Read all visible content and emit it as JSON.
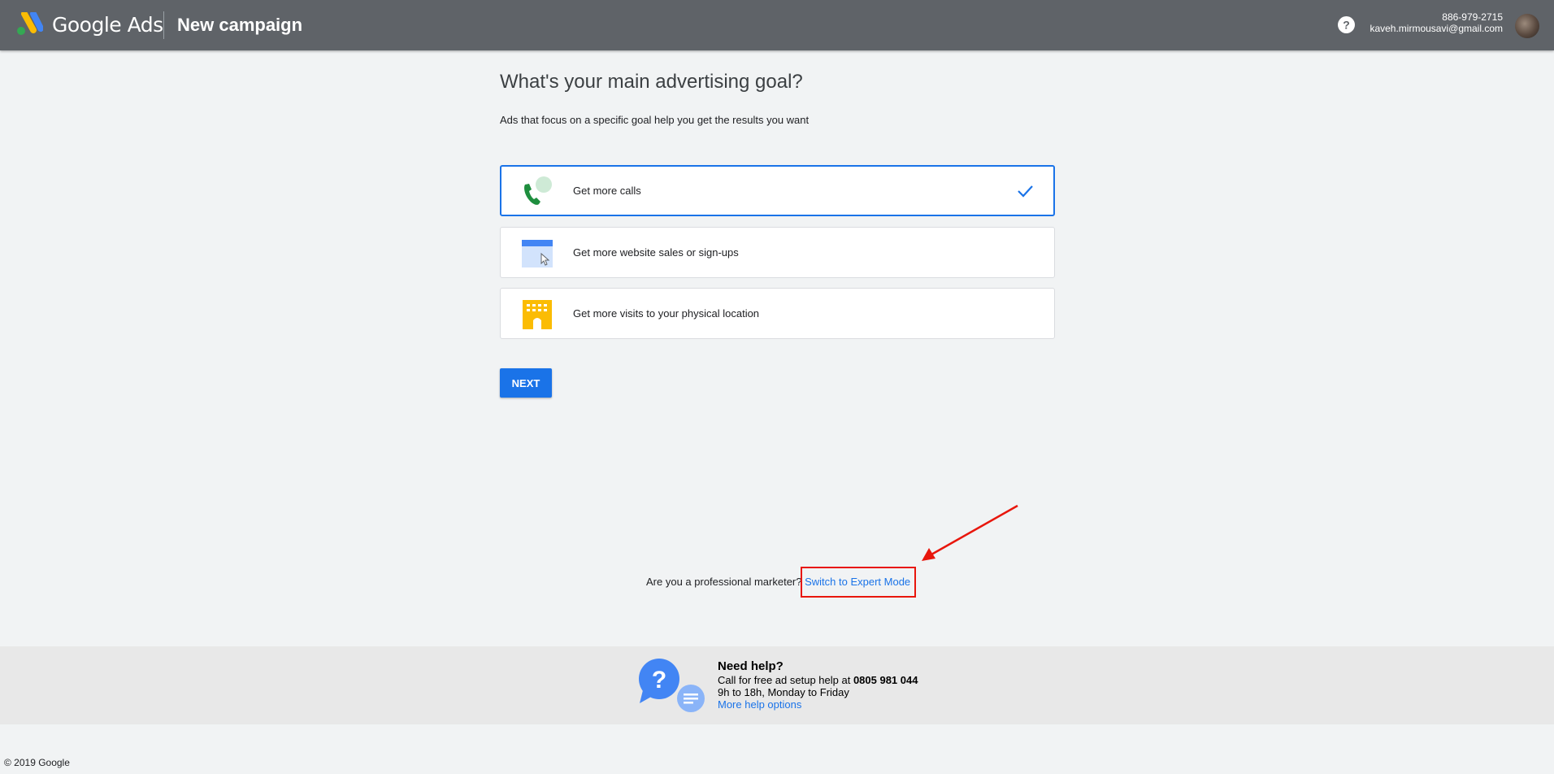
{
  "header": {
    "brand": "Google Ads",
    "page_title": "New campaign",
    "phone": "886-979-2715",
    "email": "kaveh.mirmousavi@gmail.com"
  },
  "main": {
    "title": "What's your main advertising goal?",
    "subtitle": "Ads that focus on a specific goal help you get the results you want",
    "goals": [
      {
        "label": "Get more calls",
        "icon": "phone-call-icon",
        "selected": true
      },
      {
        "label": "Get more website sales or sign-ups",
        "icon": "website-cursor-icon",
        "selected": false
      },
      {
        "label": "Get more visits to your physical location",
        "icon": "store-building-icon",
        "selected": false
      }
    ],
    "next_label": "NEXT",
    "expert_prompt": "Are you a professional marketer?",
    "expert_link": "Switch to Expert Mode"
  },
  "help": {
    "title": "Need help?",
    "line1_prefix": "Call for free ad setup help at ",
    "phone": "0805 981 044",
    "hours": "9h to 18h, Monday to Friday",
    "more_link": "More help options"
  },
  "footer": {
    "copyright": "© 2019 Google"
  },
  "colors": {
    "header_bg": "#5f6368",
    "accent": "#1a73e8",
    "highlight": "#e8160c"
  }
}
